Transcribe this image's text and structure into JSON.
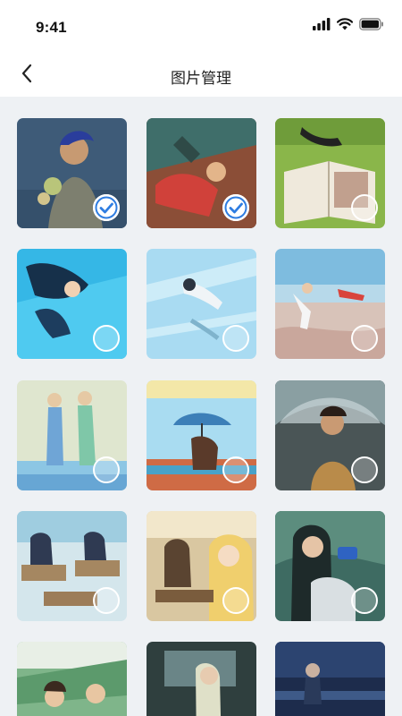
{
  "status": {
    "time": "9:41"
  },
  "nav": {
    "title": "图片管理",
    "back_icon": "chevron-left-icon"
  },
  "accent": "#2f7de1",
  "photos": [
    {
      "selected": true
    },
    {
      "selected": true
    },
    {
      "selected": false
    },
    {
      "selected": false
    },
    {
      "selected": false
    },
    {
      "selected": false
    },
    {
      "selected": false
    },
    {
      "selected": false
    },
    {
      "selected": false
    },
    {
      "selected": false
    },
    {
      "selected": false
    },
    {
      "selected": false
    },
    {
      "selected": false
    },
    {
      "selected": false
    },
    {
      "selected": false
    }
  ]
}
